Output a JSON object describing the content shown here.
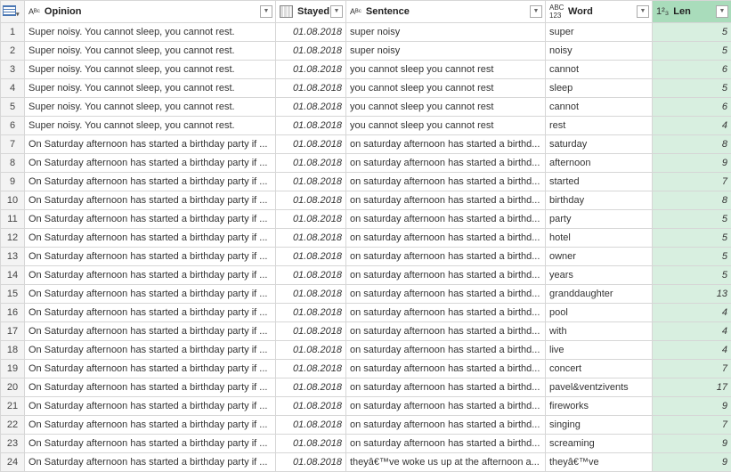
{
  "columns": [
    {
      "name": "Opinion",
      "type_icon": "ABC"
    },
    {
      "name": "Stayed",
      "type_icon": "calendar"
    },
    {
      "name": "Sentence",
      "type_icon": "ABC"
    },
    {
      "name": "Word",
      "type_icon": "ABC123"
    },
    {
      "name": "Len",
      "type_icon": "123"
    }
  ],
  "type_labels": {
    "text": "Aᴮᶜ",
    "any": "ABC 123",
    "num": "1²₃"
  },
  "rows": [
    {
      "n": "1",
      "opinion": "Super noisy. You cannot sleep, you cannot rest.",
      "stayed": "01.08.2018",
      "sentence": "super noisy",
      "word": "super",
      "len": "5"
    },
    {
      "n": "2",
      "opinion": "Super noisy. You cannot sleep, you cannot rest.",
      "stayed": "01.08.2018",
      "sentence": "super noisy",
      "word": "noisy",
      "len": "5"
    },
    {
      "n": "3",
      "opinion": "Super noisy. You cannot sleep, you cannot rest.",
      "stayed": "01.08.2018",
      "sentence": " you cannot sleep  you cannot rest",
      "word": "cannot",
      "len": "6"
    },
    {
      "n": "4",
      "opinion": "Super noisy. You cannot sleep, you cannot rest.",
      "stayed": "01.08.2018",
      "sentence": " you cannot sleep  you cannot rest",
      "word": "sleep",
      "len": "5"
    },
    {
      "n": "5",
      "opinion": "Super noisy. You cannot sleep, you cannot rest.",
      "stayed": "01.08.2018",
      "sentence": " you cannot sleep  you cannot rest",
      "word": "cannot",
      "len": "6"
    },
    {
      "n": "6",
      "opinion": "Super noisy. You cannot sleep, you cannot rest.",
      "stayed": "01.08.2018",
      "sentence": " you cannot sleep  you cannot rest",
      "word": "rest",
      "len": "4"
    },
    {
      "n": "7",
      "opinion": "On Saturday afternoon has started a birthday party if ...",
      "stayed": "01.08.2018",
      "sentence": "on saturday afternoon has started a birthd...",
      "word": "saturday",
      "len": "8"
    },
    {
      "n": "8",
      "opinion": "On Saturday afternoon has started a birthday party if ...",
      "stayed": "01.08.2018",
      "sentence": "on saturday afternoon has started a birthd...",
      "word": "afternoon",
      "len": "9"
    },
    {
      "n": "9",
      "opinion": "On Saturday afternoon has started a birthday party if ...",
      "stayed": "01.08.2018",
      "sentence": "on saturday afternoon has started a birthd...",
      "word": "started",
      "len": "7"
    },
    {
      "n": "10",
      "opinion": "On Saturday afternoon has started a birthday party if ...",
      "stayed": "01.08.2018",
      "sentence": "on saturday afternoon has started a birthd...",
      "word": "birthday",
      "len": "8"
    },
    {
      "n": "11",
      "opinion": "On Saturday afternoon has started a birthday party if ...",
      "stayed": "01.08.2018",
      "sentence": "on saturday afternoon has started a birthd...",
      "word": "party",
      "len": "5"
    },
    {
      "n": "12",
      "opinion": "On Saturday afternoon has started a birthday party if ...",
      "stayed": "01.08.2018",
      "sentence": "on saturday afternoon has started a birthd...",
      "word": "hotel",
      "len": "5"
    },
    {
      "n": "13",
      "opinion": "On Saturday afternoon has started a birthday party if ...",
      "stayed": "01.08.2018",
      "sentence": "on saturday afternoon has started a birthd...",
      "word": "owner",
      "len": "5"
    },
    {
      "n": "14",
      "opinion": "On Saturday afternoon has started a birthday party if ...",
      "stayed": "01.08.2018",
      "sentence": "on saturday afternoon has started a birthd...",
      "word": "years",
      "len": "5"
    },
    {
      "n": "15",
      "opinion": "On Saturday afternoon has started a birthday party if ...",
      "stayed": "01.08.2018",
      "sentence": "on saturday afternoon has started a birthd...",
      "word": "granddaughter",
      "len": "13"
    },
    {
      "n": "16",
      "opinion": "On Saturday afternoon has started a birthday party if ...",
      "stayed": "01.08.2018",
      "sentence": "on saturday afternoon has started a birthd...",
      "word": "pool",
      "len": "4"
    },
    {
      "n": "17",
      "opinion": "On Saturday afternoon has started a birthday party if ...",
      "stayed": "01.08.2018",
      "sentence": "on saturday afternoon has started a birthd...",
      "word": "with",
      "len": "4"
    },
    {
      "n": "18",
      "opinion": "On Saturday afternoon has started a birthday party if ...",
      "stayed": "01.08.2018",
      "sentence": "on saturday afternoon has started a birthd...",
      "word": "live",
      "len": "4"
    },
    {
      "n": "19",
      "opinion": "On Saturday afternoon has started a birthday party if ...",
      "stayed": "01.08.2018",
      "sentence": "on saturday afternoon has started a birthd...",
      "word": "concert",
      "len": "7"
    },
    {
      "n": "20",
      "opinion": "On Saturday afternoon has started a birthday party if ...",
      "stayed": "01.08.2018",
      "sentence": "on saturday afternoon has started a birthd...",
      "word": "pavel&ventzivents",
      "len": "17"
    },
    {
      "n": "21",
      "opinion": "On Saturday afternoon has started a birthday party if ...",
      "stayed": "01.08.2018",
      "sentence": "on saturday afternoon has started a birthd...",
      "word": "fireworks",
      "len": "9"
    },
    {
      "n": "22",
      "opinion": "On Saturday afternoon has started a birthday party if ...",
      "stayed": "01.08.2018",
      "sentence": "on saturday afternoon has started a birthd...",
      "word": "singing",
      "len": "7"
    },
    {
      "n": "23",
      "opinion": "On Saturday afternoon has started a birthday party if ...",
      "stayed": "01.08.2018",
      "sentence": "on saturday afternoon has started a birthd...",
      "word": "screaming",
      "len": "9"
    },
    {
      "n": "24",
      "opinion": "On Saturday afternoon has started a birthday party if ...",
      "stayed": "01.08.2018",
      "sentence": "theyâ€™ve woke us up at the afternoon a...",
      "word": "theyâ€™ve",
      "len": "9"
    }
  ]
}
